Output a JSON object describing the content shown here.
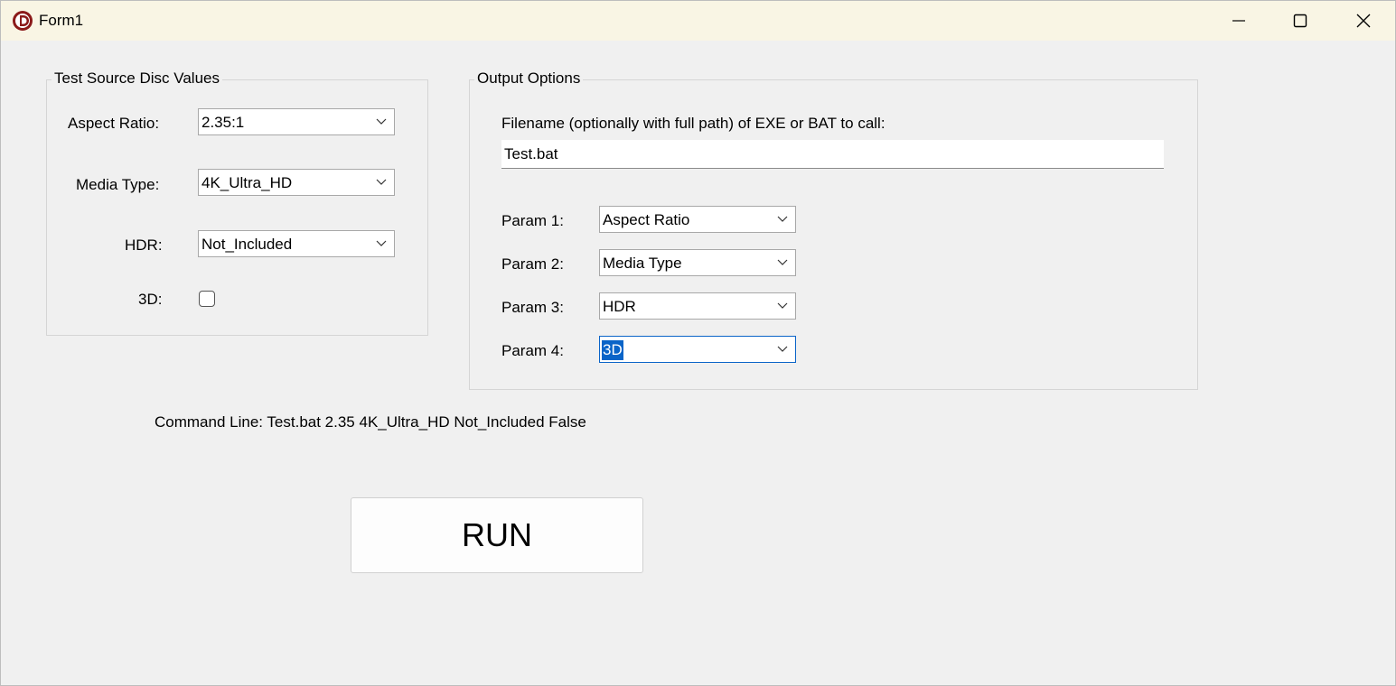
{
  "window": {
    "title": "Form1"
  },
  "source_group": {
    "legend": "Test Source Disc Values",
    "aspect_ratio_label": "Aspect Ratio:",
    "aspect_ratio_value": "2.35:1",
    "media_type_label": "Media Type:",
    "media_type_value": "4K_Ultra_HD",
    "hdr_label": "HDR:",
    "hdr_value": "Not_Included",
    "threed_label": "3D:",
    "threed_checked": false
  },
  "output_group": {
    "legend": "Output Options",
    "filename_label": "Filename (optionally with full path) of EXE or BAT to call:",
    "filename_value": "Test.bat",
    "params": [
      {
        "label": "Param 1:",
        "value": "Aspect Ratio"
      },
      {
        "label": "Param 2:",
        "value": "Media Type"
      },
      {
        "label": "Param 3:",
        "value": "HDR"
      },
      {
        "label": "Param 4:",
        "value": "3D"
      }
    ]
  },
  "command_line": "Command Line: Test.bat 2.35 4K_Ultra_HD Not_Included False",
  "run_button": "RUN",
  "colors": {
    "titlebar": "#f9f5e4",
    "background": "#f0f0f0",
    "selection": "#0a64c8",
    "app_icon": "#8b1a1a"
  },
  "icons": [
    "app-logo-icon",
    "minimize-icon",
    "maximize-icon",
    "close-icon",
    "chevron-down-icon"
  ]
}
